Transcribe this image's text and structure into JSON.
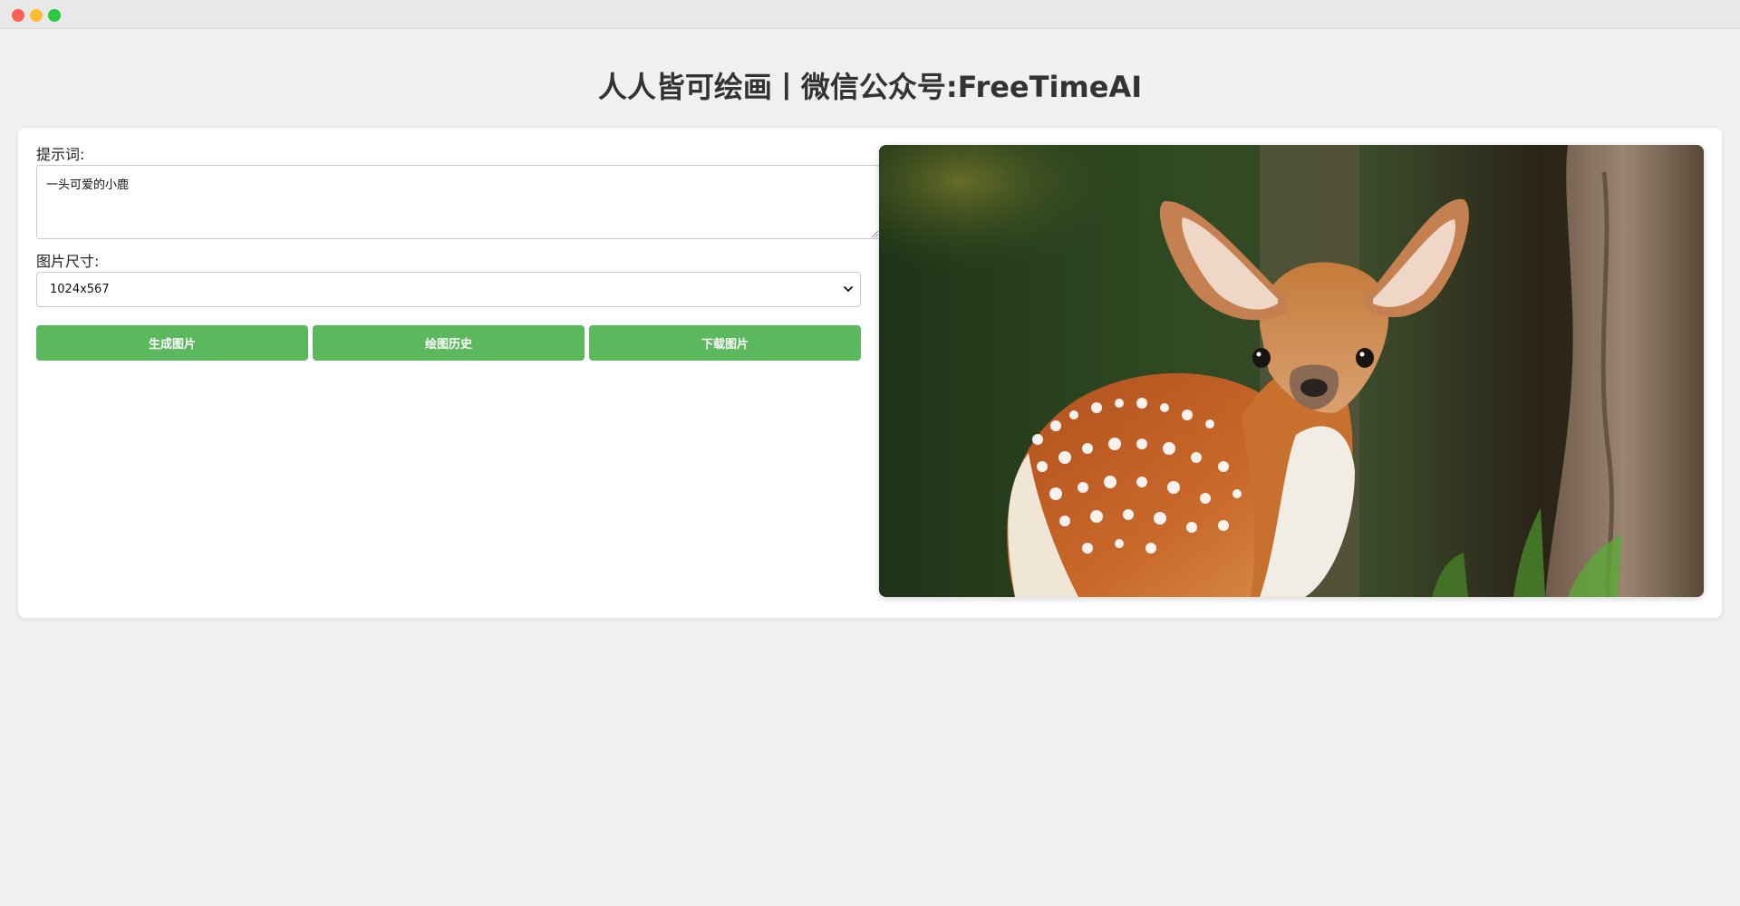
{
  "window": {
    "controls": [
      "close",
      "minimize",
      "maximize"
    ]
  },
  "header": {
    "title": "人人皆可绘画丨微信公众号:FreeTimeAI"
  },
  "form": {
    "prompt_label": "提示词:",
    "prompt_value": "一头可爱的小鹿",
    "size_label": "图片尺寸:",
    "size_selected": "1024x567",
    "buttons": {
      "generate": "生成图片",
      "history": "绘图历史",
      "download": "下载图片"
    }
  },
  "preview": {
    "subject": "fawn-image"
  },
  "colors": {
    "accent_button": "#5cb85c",
    "background": "#f0f0f0",
    "card": "#ffffff",
    "title_text": "#333333"
  }
}
